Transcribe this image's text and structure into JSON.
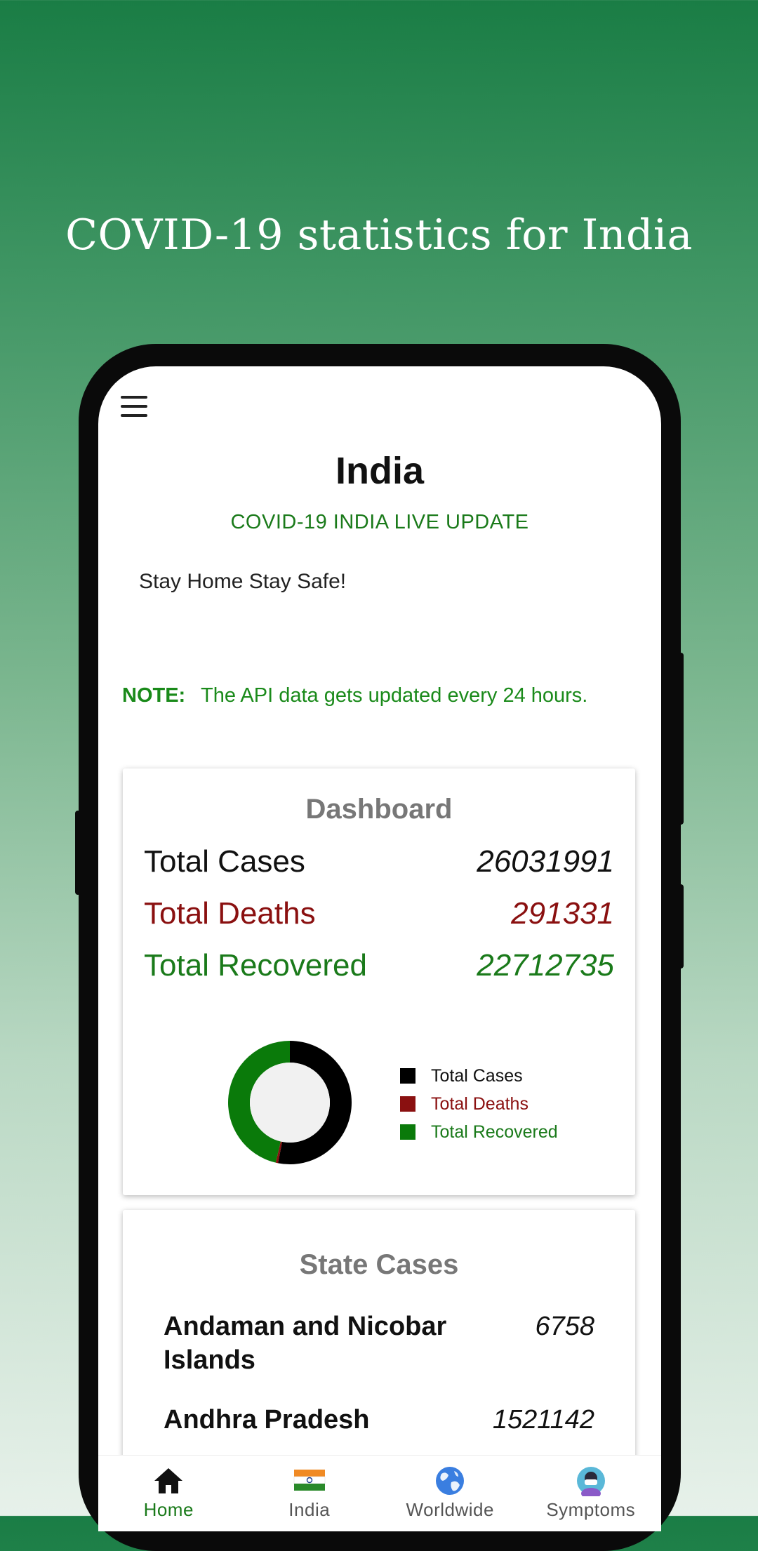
{
  "headline": "COVID-19 statistics for India",
  "header": {
    "title": "India",
    "subtitle": "COVID-19 INDIA LIVE UPDATE",
    "slogan": "Stay Home Stay Safe!"
  },
  "note": {
    "label": "NOTE:",
    "text": "The API data gets updated every 24 hours."
  },
  "dashboard": {
    "title": "Dashboard",
    "stats": [
      {
        "label": "Total Cases",
        "value": "26031991",
        "color": "#111111"
      },
      {
        "label": "Total Deaths",
        "value": "291331",
        "color": "#8a1010"
      },
      {
        "label": "Total Recovered",
        "value": "22712735",
        "color": "#1a7a1a"
      }
    ]
  },
  "chart_data": {
    "type": "pie",
    "categories": [
      "Total Cases",
      "Total Deaths",
      "Total Recovered"
    ],
    "values": [
      26031991,
      291331,
      22712735
    ],
    "colors": [
      "#000000",
      "#8a1010",
      "#0a7a0a"
    ],
    "donut": true,
    "legend": "right"
  },
  "state_cases": {
    "title": "State Cases",
    "rows": [
      {
        "name": "Andaman and Nicobar Islands",
        "value": "6758"
      },
      {
        "name": "Andhra Pradesh",
        "value": "1521142"
      }
    ]
  },
  "nav": {
    "items": [
      {
        "label": "Home",
        "icon": "home-icon",
        "active": true
      },
      {
        "label": "India",
        "icon": "india-flag-icon",
        "active": false
      },
      {
        "label": "Worldwide",
        "icon": "globe-icon",
        "active": false
      },
      {
        "label": "Symptoms",
        "icon": "symptoms-icon",
        "active": false
      }
    ]
  }
}
